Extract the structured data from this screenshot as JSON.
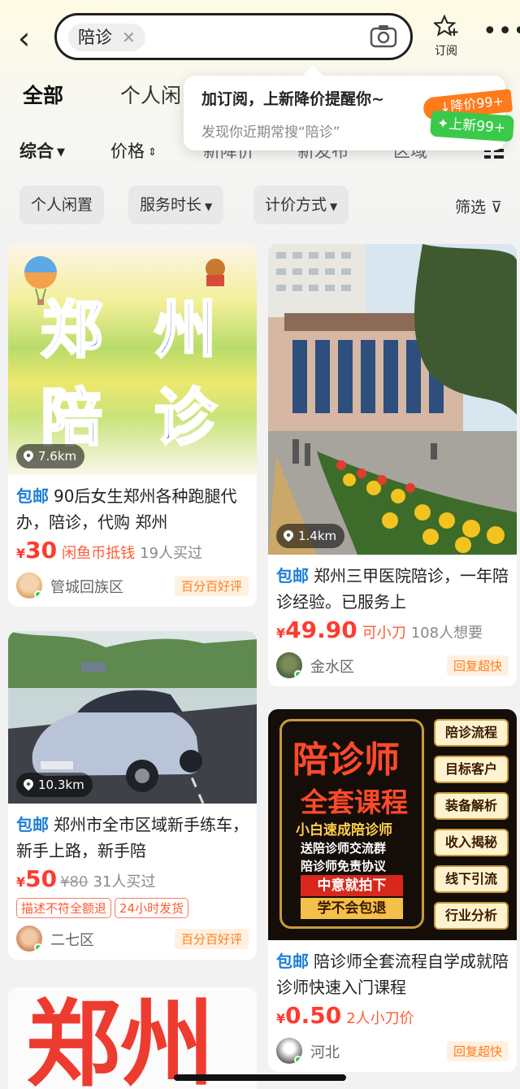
{
  "search": {
    "query": "陪诊",
    "clear": "✕"
  },
  "header": {
    "back": "‹",
    "subscribe": "订阅",
    "more": "•••"
  },
  "tabs": [
    "全部",
    "个人闲"
  ],
  "popup": {
    "title": "加订阅，上新降价提醒你~",
    "subtitle": "发现你近期常搜“陪诊”",
    "badge_drop": "↓降价99+",
    "badge_new": "✦上新99+"
  },
  "sorts": [
    "综合",
    "价格",
    "新降价",
    "新发布",
    "区域"
  ],
  "filters": [
    "个人闲置",
    "服务时长",
    "计价方式"
  ],
  "screen_filter": "筛选",
  "colors": {
    "accent_yellow": "#ffe14d",
    "price_red": "#ff3b2f",
    "tag_blue": "#1e7ed6",
    "online_green": "#2dc84d"
  },
  "listings": [
    {
      "cover_words": [
        "郑",
        "州",
        "陪",
        "诊"
      ],
      "distance": "7.6km",
      "tag": "包邮",
      "title": "90后女生郑州各种跑腿代办，陪诊，代购 郑州",
      "yen": "¥",
      "price": "30",
      "note": "闲鱼币抵钱",
      "buyers": "19人买过",
      "seller": "管城回族区",
      "badge": "百分百好评"
    },
    {
      "distance": "1.4km",
      "tag": "包邮",
      "title": "郑州三甲医院陪诊，一年陪诊经验。已服务上",
      "yen": "¥",
      "price": "49.90",
      "note": "可小刀",
      "buyers": "108人想要",
      "seller": "金水区",
      "badge": "回复超快"
    },
    {
      "distance": "10.3km",
      "tag": "包邮",
      "title": "郑州市全市区域新手练车，新手上路，新手陪",
      "yen": "¥",
      "price": "50",
      "orig": "¥80",
      "buyers": "31人买过",
      "pills": [
        "描述不符全额退",
        "24小时发货"
      ],
      "seller": "二七区",
      "badge": "百分百好评"
    },
    {
      "cover_title1": "陪诊师",
      "cover_title2": "全套课程",
      "cover_lines": [
        "小白速成陪诊师",
        "送陪诊师交流群",
        "陪诊师免责协议"
      ],
      "cover_btn1": "中意就拍下",
      "cover_btn2": "学不会包退",
      "cover_tags": [
        "陪诊流程",
        "目标客户",
        "装备解析",
        "收入揭秘",
        "线下引流",
        "行业分析"
      ],
      "tag": "包邮",
      "title": "陪诊师全套流程自学成就陪诊师快速入门课程",
      "yen": "¥",
      "price": "0.50",
      "buyers": "2人小刀价",
      "seller": "河北",
      "badge": "回复超快"
    },
    {
      "cover_words": [
        "郑州"
      ]
    }
  ]
}
